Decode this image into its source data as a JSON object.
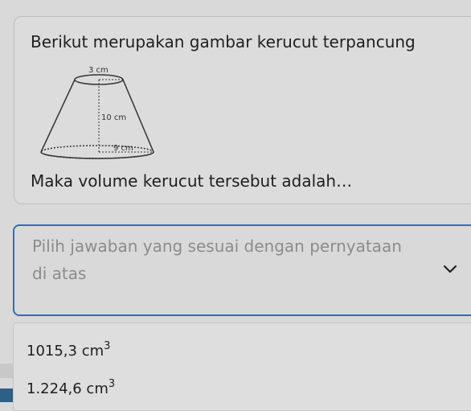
{
  "question": {
    "prompt": "Berikut merupakan gambar kerucut terpancung",
    "followup": "Maka volume kerucut tersebut adalah…",
    "figure": {
      "top_label": "3 cm",
      "height_label": "10 cm",
      "bottom_label": "9 cm"
    }
  },
  "answer_select": {
    "placeholder": "Pilih jawaban yang sesuai dengan pernyataan di atas",
    "icon": "chevron-down-icon"
  },
  "options": [
    {
      "value": "1015,3 cm",
      "exponent": "3"
    },
    {
      "value": "1.224,6 cm",
      "exponent": "3"
    }
  ],
  "colors": {
    "focus_border": "#2b6fc2",
    "placeholder": "#8c8c8c"
  }
}
